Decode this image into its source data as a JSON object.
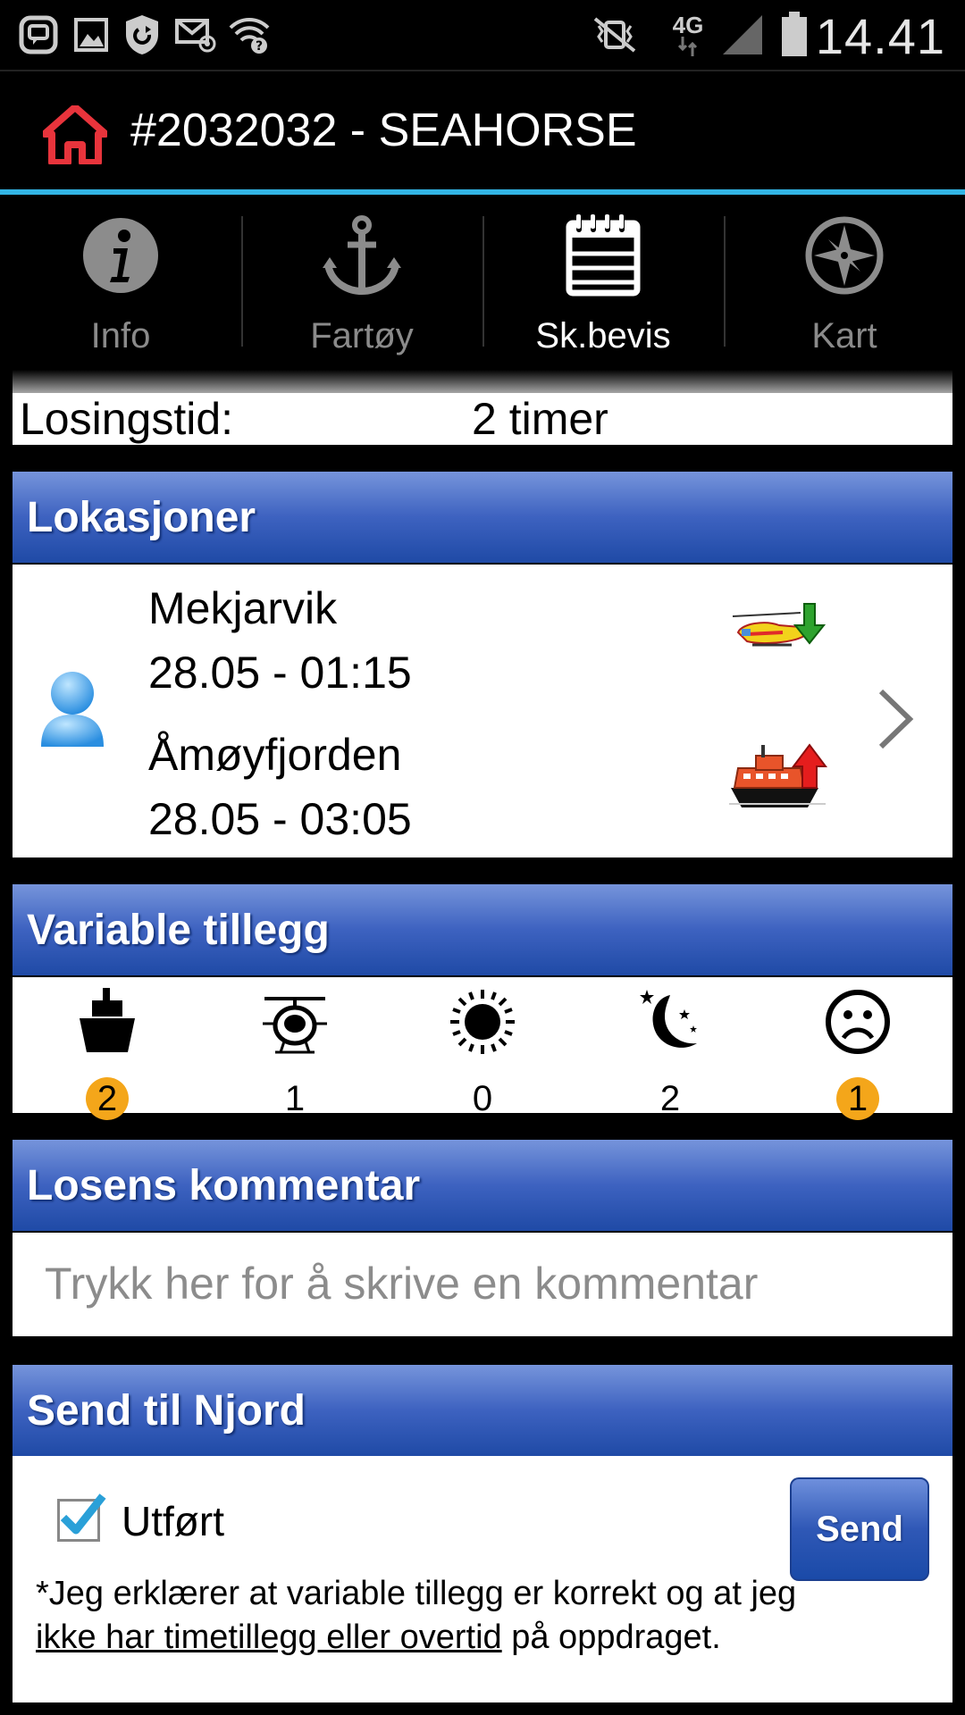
{
  "status_bar": {
    "time": "14.41",
    "network": "4G",
    "icons": [
      "bbm-icon",
      "gallery-icon",
      "shield-sync-icon",
      "mail-icon",
      "wifi-question-icon",
      "vibrate-mute-icon",
      "network-4g-icon",
      "signal-icon",
      "battery-icon"
    ]
  },
  "titlebar": {
    "title": "#2032032 - SEAHORSE",
    "home_icon_color": "#e8343c"
  },
  "tabs": [
    {
      "label": "Info",
      "icon": "info-icon",
      "active": false
    },
    {
      "label": "Fartøy",
      "icon": "anchor-icon",
      "active": false
    },
    {
      "label": "Sk.bevis",
      "icon": "calendar-icon",
      "active": true
    },
    {
      "label": "Kart",
      "icon": "compass-icon",
      "active": false
    }
  ],
  "losingstid": {
    "label": "Losingstid:",
    "value": "2 timer"
  },
  "lokasjoner": {
    "header": "Lokasjoner",
    "from": {
      "place": "Mekjarvik",
      "time": "28.05 - 01:15",
      "icon": "helicopter-down-icon"
    },
    "to": {
      "place": "Åmøyfjorden",
      "time": "28.05 - 03:05",
      "icon": "boat-up-icon"
    }
  },
  "variable_tillegg": {
    "header": "Variable tillegg",
    "items": [
      {
        "icon": "ship-icon",
        "count": "2",
        "highlight": true
      },
      {
        "icon": "helicopter-icon",
        "count": "1",
        "highlight": false
      },
      {
        "icon": "sun-icon",
        "count": "0",
        "highlight": false
      },
      {
        "icon": "moon-stars-icon",
        "count": "2",
        "highlight": false
      },
      {
        "icon": "sad-face-icon",
        "count": "1",
        "highlight": true
      }
    ]
  },
  "losens_kommentar": {
    "header": "Losens kommentar",
    "placeholder": "Trykk her for å skrive en kommentar"
  },
  "send_til_njord": {
    "header": "Send til Njord",
    "checkbox_label": "Utført",
    "checked": true,
    "button_label": "Send",
    "declaration_start": "*Jeg erklærer at variable tillegg er korrekt og at jeg ",
    "declaration_underlined": "ikke har timetillegg eller overtid",
    "declaration_end": " på oppdraget."
  },
  "colors": {
    "accent_line": "#33b5e5",
    "header_gradient_top": "#7694db",
    "header_gradient_bottom": "#1f4aa6",
    "badge": "#f4a61a"
  }
}
